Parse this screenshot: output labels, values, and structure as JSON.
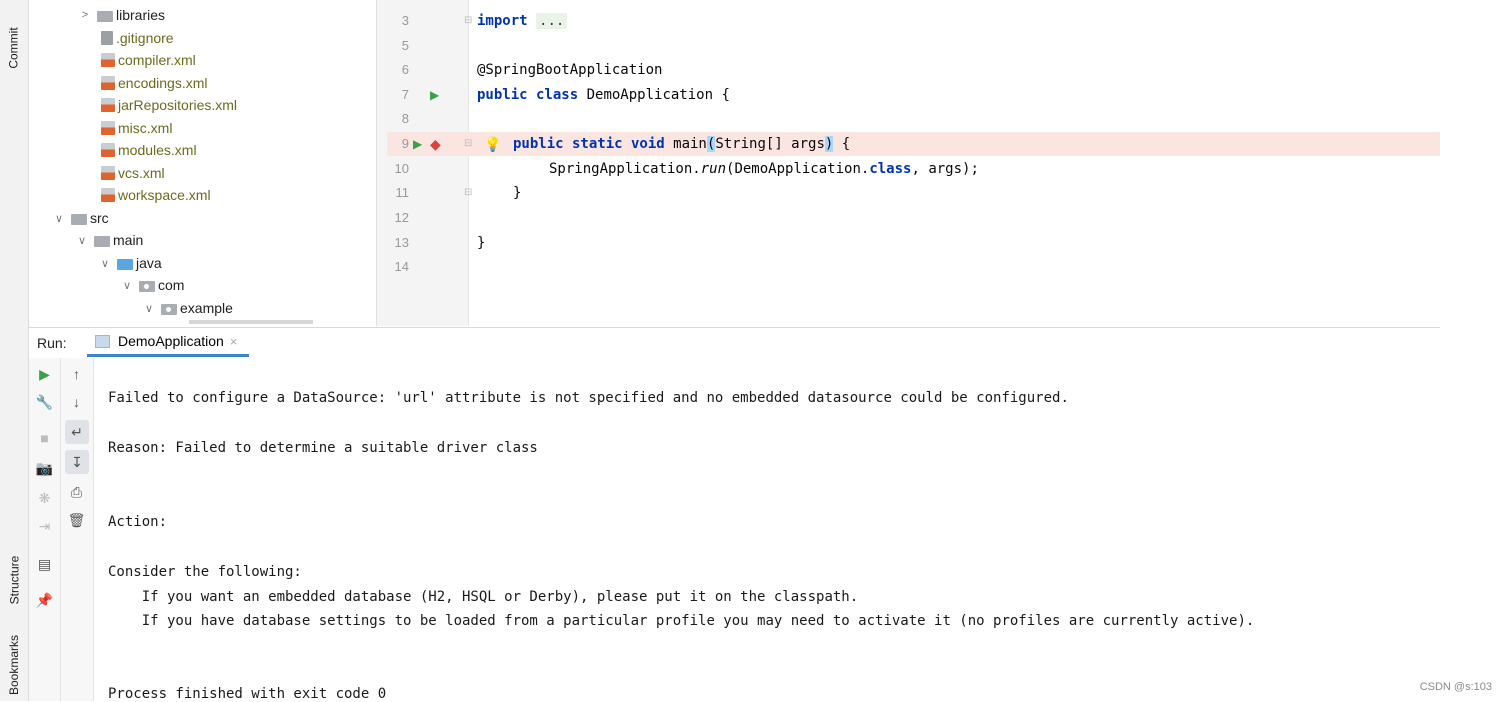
{
  "sidebar_tabs": {
    "commit": "Commit",
    "structure": "Structure",
    "bookmarks": "Bookmarks"
  },
  "project_tree": [
    {
      "label": "libraries",
      "kind": "folder",
      "arrow": ">"
    },
    {
      "label": ".gitignore",
      "kind": "git"
    },
    {
      "label": "compiler.xml",
      "kind": "xml"
    },
    {
      "label": "encodings.xml",
      "kind": "xml"
    },
    {
      "label": "jarRepositories.xml",
      "kind": "xml"
    },
    {
      "label": "misc.xml",
      "kind": "xml"
    },
    {
      "label": "modules.xml",
      "kind": "xml"
    },
    {
      "label": "vcs.xml",
      "kind": "xml"
    },
    {
      "label": "workspace.xml",
      "kind": "xml"
    },
    {
      "label": "src",
      "kind": "folder",
      "arrow": "v"
    },
    {
      "label": "main",
      "kind": "folder",
      "arrow": "v"
    },
    {
      "label": "java",
      "kind": "folder-blue",
      "arrow": "v"
    },
    {
      "label": "com",
      "kind": "package",
      "arrow": "v"
    },
    {
      "label": "example",
      "kind": "package",
      "arrow": "v"
    }
  ],
  "editor": {
    "line_numbers": [
      "3",
      "5",
      "6",
      "7",
      "8",
      "9",
      "10",
      "11",
      "12",
      "13",
      "14"
    ],
    "import_kw": "import",
    "import_fold": "...",
    "annotation": "@SpringBootApplication",
    "class_decl_kw": "public class",
    "class_name": " DemoApplication {",
    "main_kw": "public static void",
    "main_name": " main",
    "main_paren_open": "(",
    "main_params": "String[] args",
    "main_paren_close": ")",
    "main_brace": " {",
    "run_call_prefix": "SpringApplication.",
    "run_call_method": "run",
    "run_call_args_a": "(DemoApplication.",
    "run_call_class_kw": "class",
    "run_call_args_b": ", args);",
    "close_method": "}",
    "close_class": "}"
  },
  "run_panel": {
    "label": "Run:",
    "tab_label": "DemoApplication",
    "tab_close": "×"
  },
  "console": {
    "lines": [
      "Failed to configure a DataSource: 'url' attribute is not specified and no embedded datasource could be configured.",
      "Reason: Failed to determine a suitable driver class",
      "Action:",
      "Consider the following:",
      "    If you want an embedded database (H2, HSQL or Derby), please put it on the classpath.",
      "    If you have database settings to be loaded from a particular profile you may need to activate it (no profiles are currently active).",
      "Process finished with exit code 0"
    ]
  },
  "watermark": "CSDN @s:103"
}
